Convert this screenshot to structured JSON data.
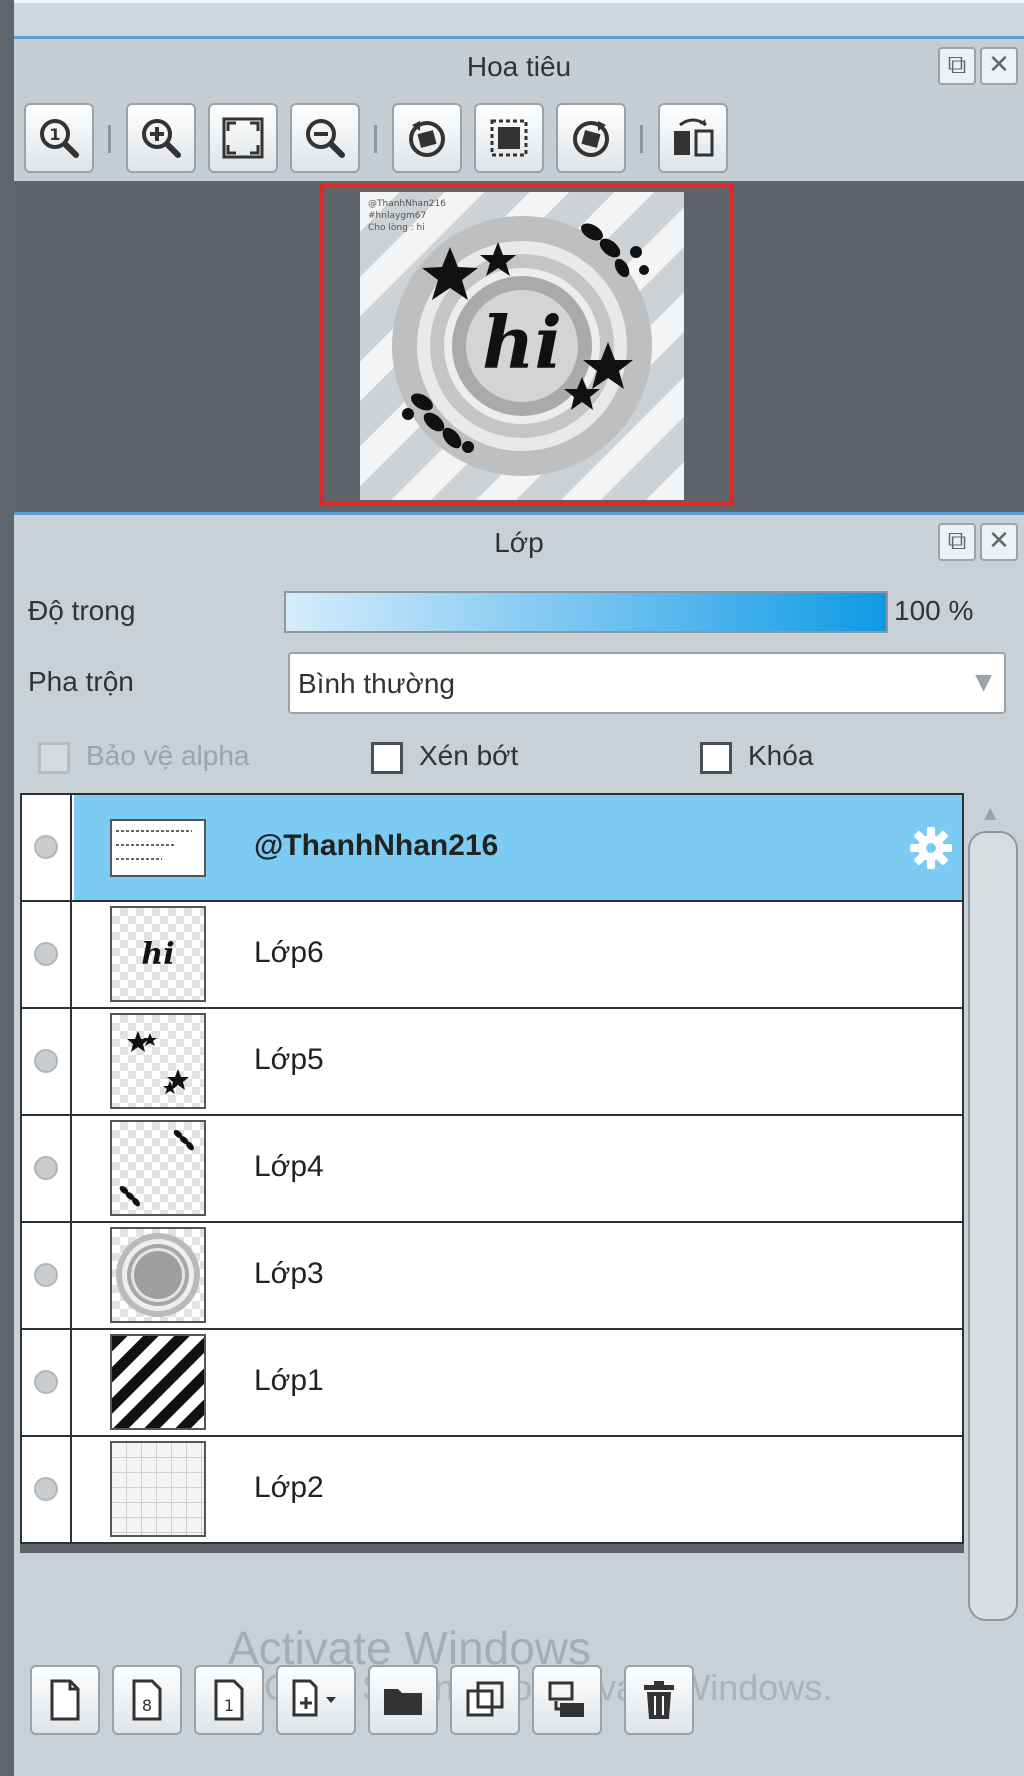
{
  "navigator": {
    "title": "Hoa tiêu",
    "toolbar_icons": [
      "zoom-actual-size-icon",
      "zoom-in-icon",
      "fit-to-window-icon",
      "zoom-out-icon",
      "rotate-left-icon",
      "reset-view-icon",
      "rotate-right-icon",
      "flip-horizontal-icon"
    ],
    "preview_text": [
      "@ThanhNhan216",
      "#hnlaygm67",
      "Cho lòng : hi"
    ],
    "preview_lettering": "hi"
  },
  "layers_panel": {
    "title": "Lớp",
    "opacity": {
      "label": "Độ trong",
      "value": "100 %",
      "level": 1.0
    },
    "blend": {
      "label": "Pha trộn",
      "value": "Bình thường"
    },
    "checkboxes": [
      {
        "label": "Bảo vệ alpha",
        "checked": false,
        "enabled": false
      },
      {
        "label": "Xén bớt",
        "checked": false,
        "enabled": true
      },
      {
        "label": "Khóa",
        "checked": false,
        "enabled": true
      }
    ],
    "layers": [
      {
        "name": "@ThanhNhan216",
        "selected": true,
        "thumb": "text-layer"
      },
      {
        "name": "Lớp6",
        "selected": false,
        "thumb": "hi-lettering"
      },
      {
        "name": "Lớp5",
        "selected": false,
        "thumb": "stars"
      },
      {
        "name": "Lớp4",
        "selected": false,
        "thumb": "leaves"
      },
      {
        "name": "Lớp3",
        "selected": false,
        "thumb": "rings"
      },
      {
        "name": "Lớp1",
        "selected": false,
        "thumb": "stripes"
      },
      {
        "name": "Lớp2",
        "selected": false,
        "thumb": "grid"
      }
    ],
    "bottom_icons": [
      "new-layer-icon",
      "new-8bit-layer-icon",
      "new-1bit-layer-icon",
      "add-layer-menu-icon",
      "new-folder-icon",
      "duplicate-layer-icon",
      "merge-down-icon",
      "delete-layer-icon"
    ]
  },
  "overlay": {
    "line1": "Activate Windows",
    "line2": "Go to Settings to activate Windows."
  },
  "colors": {
    "accent": "#5a9fd0",
    "selected_row": "#7ccbf3",
    "preview_border": "#e0282a",
    "opacity_fill": "#0f9ae6"
  }
}
